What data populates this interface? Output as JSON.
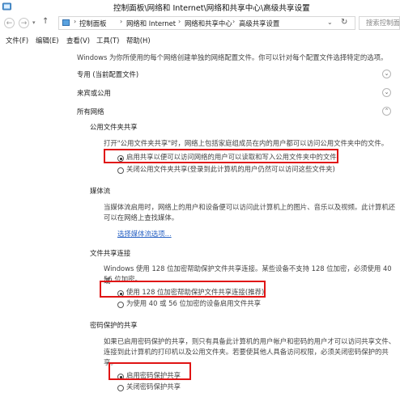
{
  "window": {
    "title": "控制面板\\网络和 Internet\\网络和共享中心\\高级共享设置"
  },
  "nav": {
    "back_icon": "back-arrow",
    "forward_icon": "forward-arrow",
    "up_icon": "up-arrow",
    "breadcrumbs": [
      "控制面板",
      "网络和 Internet",
      "网络和共享中心",
      "高级共享设置"
    ],
    "search_placeholder": "搜索控制面"
  },
  "menu": [
    "文件(F)",
    "编辑(E)",
    "查看(V)",
    "工具(T)",
    "帮助(H)"
  ],
  "intro": "Windows 为你所使用的每个网络创建单独的网络配置文件。你可以针对每个配置文件选择特定的选项。",
  "profiles": [
    {
      "label": "专用 (当前配置文件)",
      "expanded": false
    },
    {
      "label": "来宾或公用",
      "expanded": false
    },
    {
      "label": "所有网络",
      "expanded": true
    }
  ],
  "public_folder": {
    "heading": "公用文件夹共享",
    "description": "打开\"公用文件夹共享\"时，网络上包括家庭组成员在内的用户都可以访问公用文件夹中的文件。",
    "options": [
      {
        "label": "启用共享以便可以访问网络的用户可以读取和写入公用文件夹中的文件",
        "selected": true
      },
      {
        "label": "关闭公用文件夹共享(登录到此计算机的用户仍然可以访问这些文件夹)",
        "selected": false
      }
    ]
  },
  "media": {
    "heading": "媒体流",
    "description_line1": "当媒体流启用时，网络上的用户和设备便可以访问此计算机上的图片、音乐以及视频。此计算机还",
    "description_line2": "可以在网络上查找媒体。",
    "link": "选择媒体流选项..."
  },
  "file_sharing": {
    "heading": "文件共享连接",
    "description_line1": "Windows 使用 128 位加密帮助保护文件共享连接。某些设备不支持 128 位加密，必须使用 40 或",
    "description_line2": "56 位加密。",
    "options": [
      {
        "label": "使用 128 位加密帮助保护文件共享连接(推荐)",
        "selected": true
      },
      {
        "label": "为使用 40 或 56 位加密的设备启用文件共享",
        "selected": false
      }
    ]
  },
  "password": {
    "heading": "密码保护的共享",
    "description_line1": "如果已启用密码保护的共享，则只有具备此计算机的用户帐户和密码的用户才可以访问共享文件、",
    "description_line2": "连接到此计算机的打印机以及公用文件夹。若要使其他人具备访问权限，必须关闭密码保护的共",
    "description_line3": "享。",
    "options": [
      {
        "label": "启用密码保护共享",
        "selected": true
      },
      {
        "label": "关闭密码保护共享",
        "selected": false
      }
    ]
  },
  "colors": {
    "highlight": "#e01414",
    "link": "#2a63c4"
  }
}
